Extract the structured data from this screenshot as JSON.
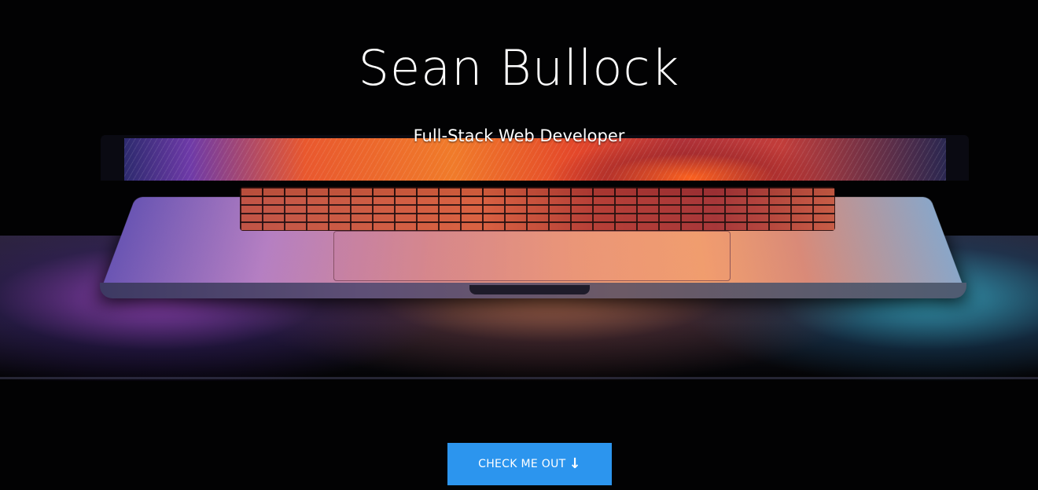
{
  "hero": {
    "name": "Sean Bullock",
    "tagline": "Full-Stack Web Developer",
    "cta_label": "CHECK ME OUT",
    "cta_icon": "arrow-down-icon",
    "cta_color": "#2c95ee",
    "background_color": "#000000"
  }
}
